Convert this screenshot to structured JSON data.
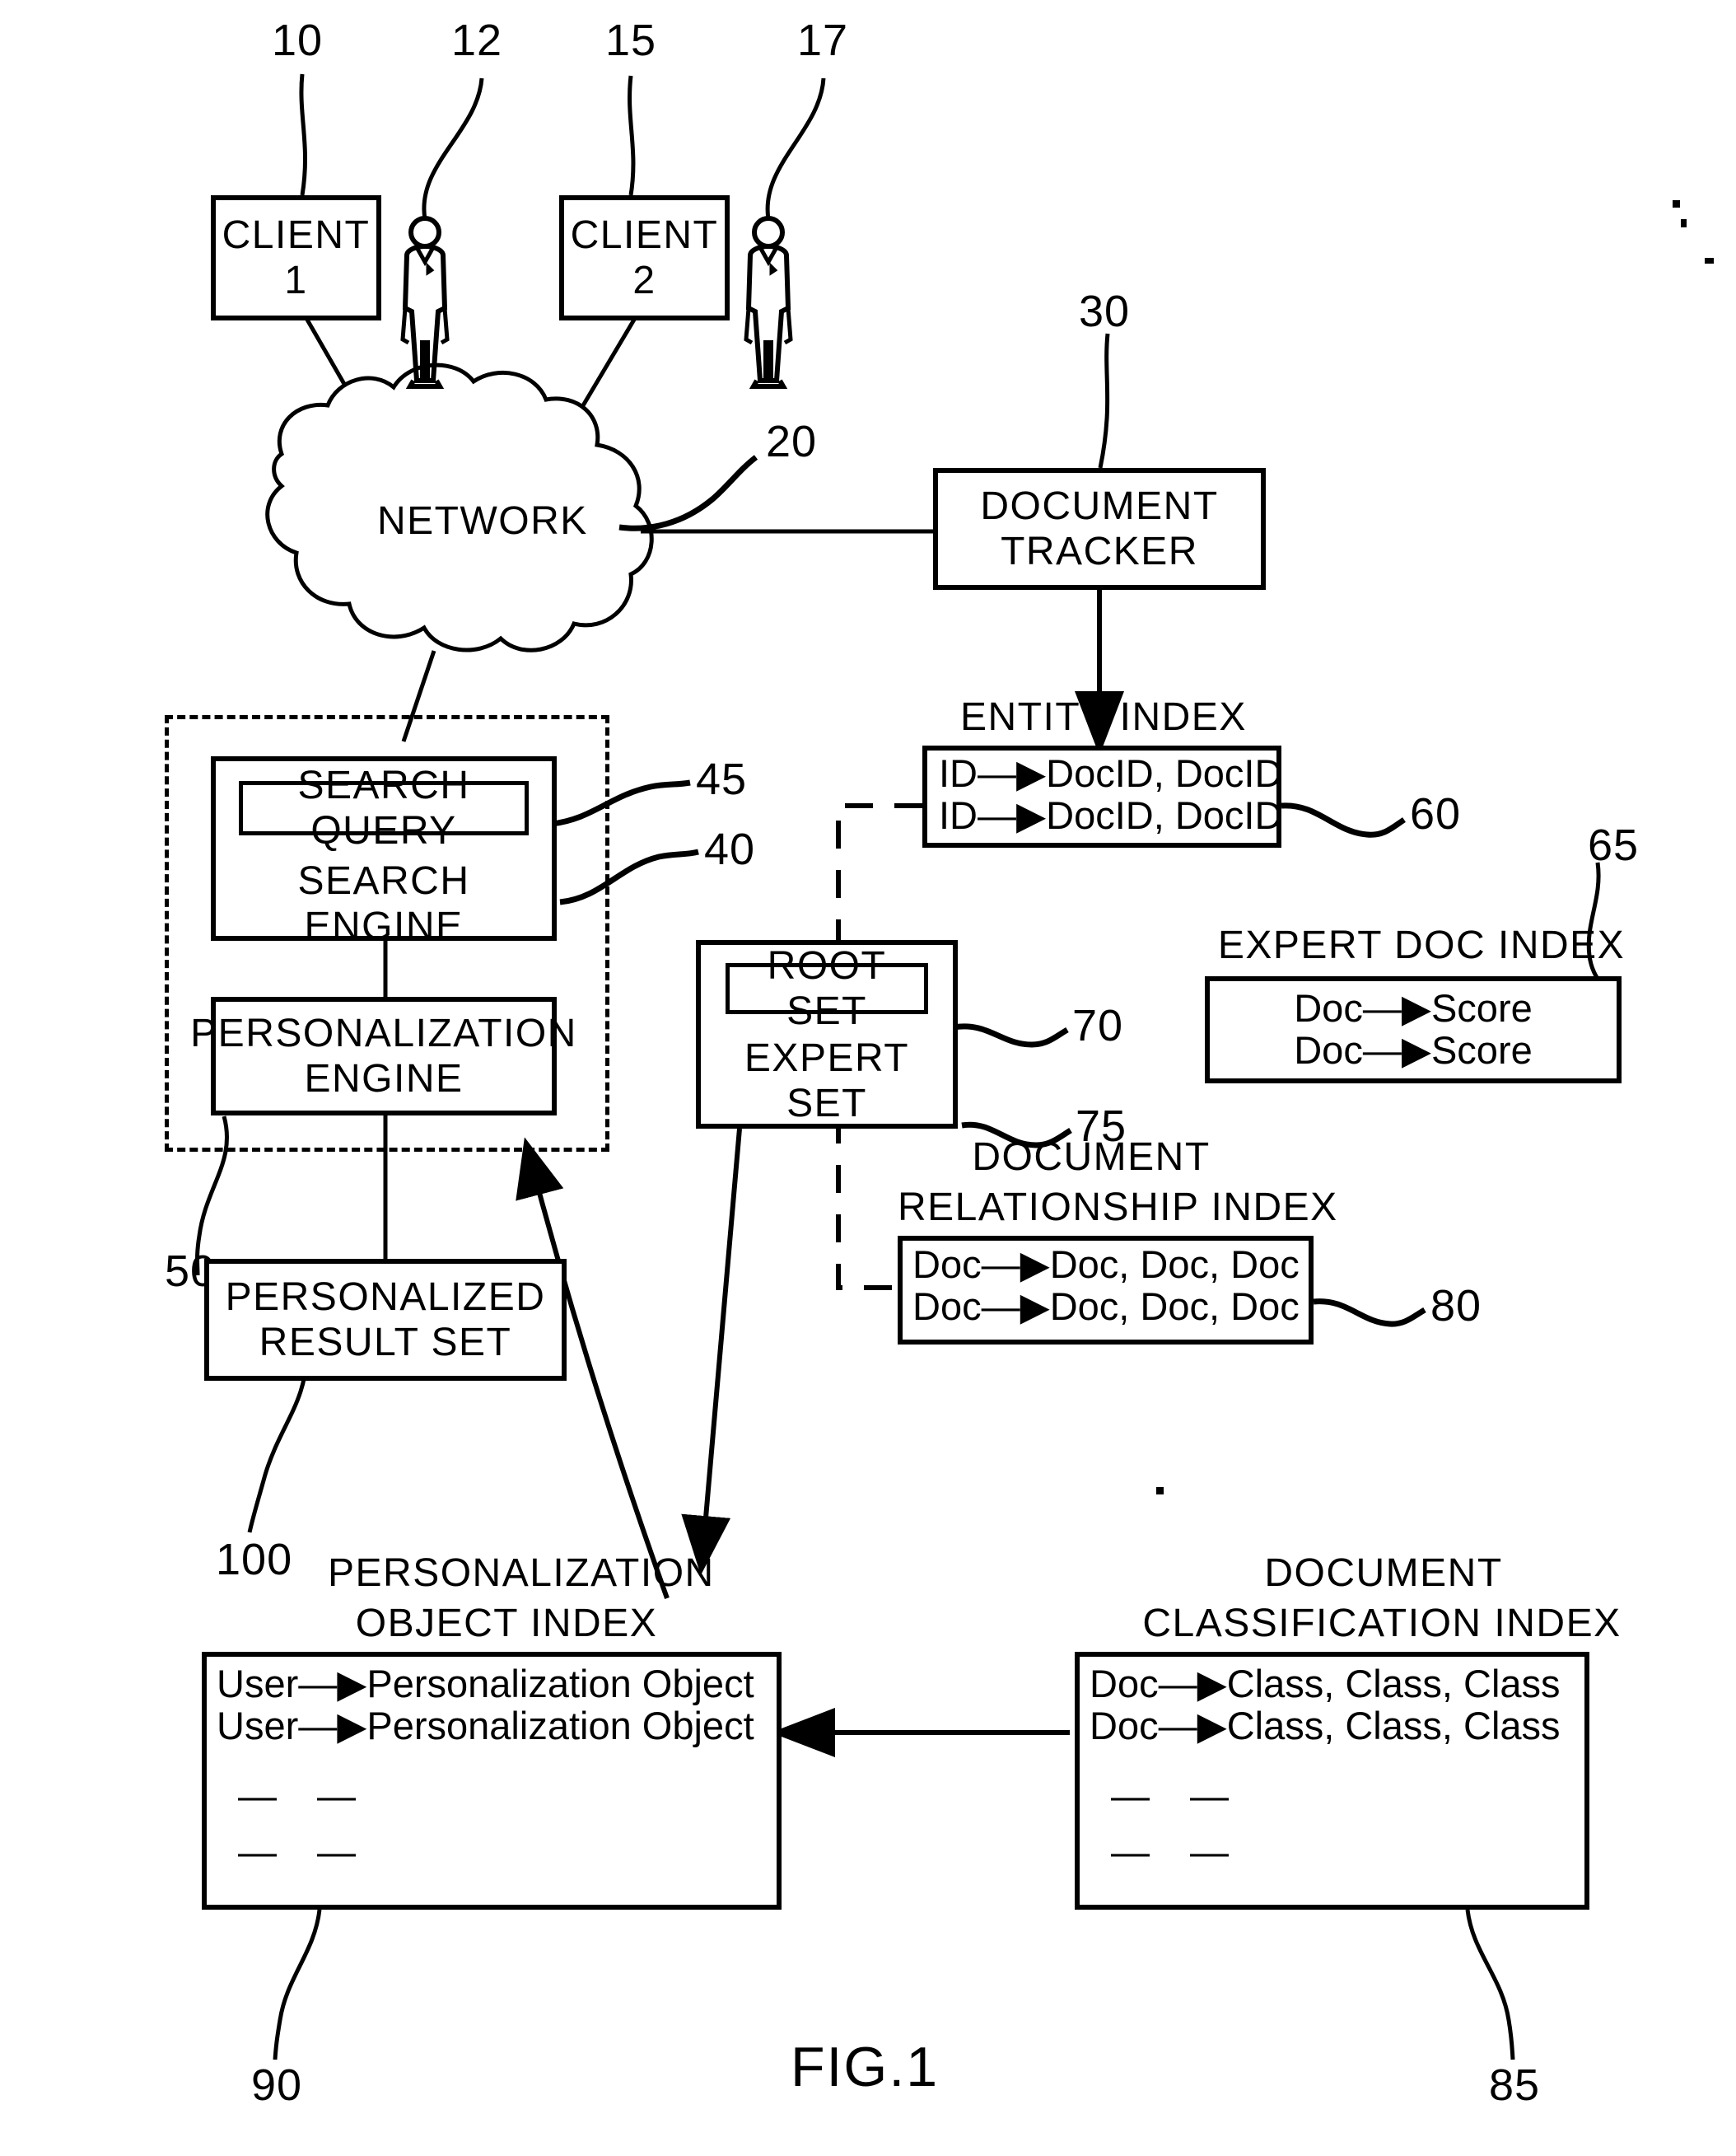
{
  "figure": {
    "title": "FIG.1",
    "reference_numerals": {
      "client1": "10",
      "user1": "12",
      "client2": "15",
      "user2": "17",
      "network": "20",
      "document_tracker": "30",
      "search_engine": "40",
      "search_query": "45",
      "personalization_engine": "50",
      "entity_index": "60",
      "expert_doc_index": "65",
      "root_set": "70",
      "expert_set": "75",
      "document_relationship_index": "80",
      "document_classification_index": "85",
      "personalization_object_index": "90",
      "personalized_result_set": "100"
    }
  },
  "nodes": {
    "client1": {
      "line1": "CLIENT",
      "line2": "1"
    },
    "client2": {
      "line1": "CLIENT",
      "line2": "2"
    },
    "network": {
      "label": "NETWORK"
    },
    "document_tracker": {
      "line1": "DOCUMENT",
      "line2": "TRACKER"
    },
    "search_engine": {
      "query_label": "SEARCH QUERY",
      "engine_label": "SEARCH ENGINE"
    },
    "personalization_engine": {
      "line1": "PERSONALIZATION",
      "line2": "ENGINE"
    },
    "personalized_result_set": {
      "line1": "PERSONALIZED",
      "line2": "RESULT SET"
    },
    "set_box": {
      "root_label": "ROOT SET",
      "expert_label": "EXPERT SET"
    }
  },
  "indexes": {
    "entity_index": {
      "caption": "ENTITY  INDEX",
      "rows": [
        "ID—▶DocID,  DocID",
        "ID—▶DocID,  DocID"
      ]
    },
    "expert_doc_index": {
      "caption": "EXPERT DOC INDEX",
      "rows": [
        "Doc—▶Score",
        "Doc—▶Score"
      ]
    },
    "document_relationship_index": {
      "caption_line1": "DOCUMENT",
      "caption_line2": "RELATIONSHIP  INDEX",
      "rows": [
        "Doc—▶Doc,  Doc,  Doc",
        "Doc—▶Doc,  Doc,  Doc"
      ]
    },
    "personalization_object_index": {
      "caption_line1": "PERSONALIZATION",
      "caption_line2": "OBJECT  INDEX",
      "rows": [
        "User—▶Personalization  Object",
        "User—▶Personalization  Object"
      ],
      "ellipsis_rows": [
        "—    —",
        "—    —"
      ]
    },
    "document_classification_index": {
      "caption_line1": "DOCUMENT",
      "caption_line2": "CLASSIFICATION  INDEX",
      "rows": [
        "Doc—▶Class,  Class,  Class",
        "Doc—▶Class,  Class,  Class"
      ],
      "ellipsis_rows": [
        "—    —",
        "—    —"
      ]
    }
  },
  "colors": {
    "ink": "#000000",
    "paper": "#ffffff"
  }
}
